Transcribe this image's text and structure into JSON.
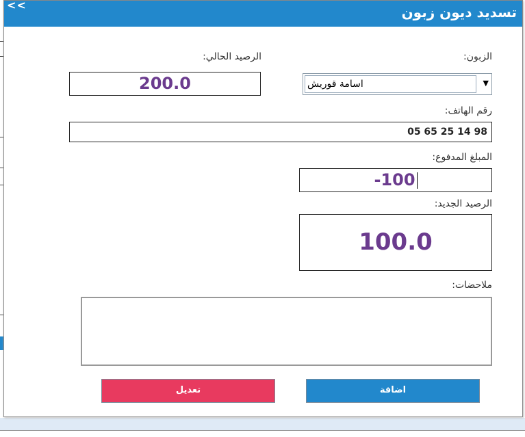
{
  "window": {
    "title": "تسديد ديون زبون",
    "back_label": "<<"
  },
  "form": {
    "customer_label": "الزبون:",
    "customer_value": "اسامة قوريش",
    "current_balance_label": "الرصيد الحالي:",
    "current_balance_value": "200.0",
    "phone_label": "رقم الهاتف:",
    "phone_value": "05 65 25 14 98",
    "paid_amount_label": "المبلغ المدفوع:",
    "paid_amount_value": "-100",
    "new_balance_label": "الرصيد الجديد:",
    "new_balance_value": "100.0",
    "notes_label": "ملاحضات:",
    "notes_value": ""
  },
  "buttons": {
    "add": "اضافة",
    "edit": "تعديل"
  },
  "colors": {
    "accent": "#2288cc",
    "danger": "#e83a5f",
    "value_text": "#6b3b8e"
  }
}
